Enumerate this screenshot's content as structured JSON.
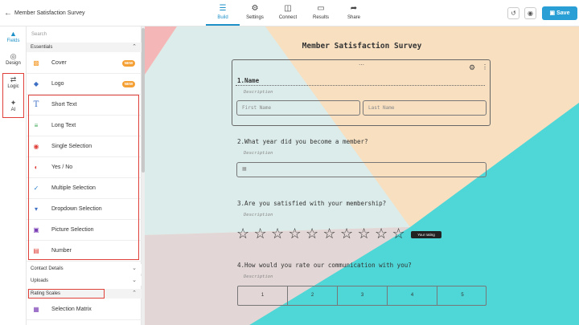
{
  "header": {
    "title": "Member Satisfaction Survey",
    "tabs": [
      {
        "label": "Build",
        "icon": "layers-icon"
      },
      {
        "label": "Settings",
        "icon": "gear-icon"
      },
      {
        "label": "Connect",
        "icon": "connect-icon"
      },
      {
        "label": "Results",
        "icon": "inbox-icon"
      },
      {
        "label": "Share",
        "icon": "share-arrow-icon"
      }
    ],
    "save_label": "Save"
  },
  "rail": {
    "items": [
      {
        "label": "Fields",
        "icon": "fields-icon"
      },
      {
        "label": "Design",
        "icon": "palette-icon"
      },
      {
        "label": "Logic",
        "icon": "shuffle-icon"
      },
      {
        "label": "AI",
        "icon": "sparkle-icon"
      }
    ]
  },
  "panel": {
    "search_placeholder": "Search",
    "essentials_label": "Essentials",
    "essentials": [
      {
        "label": "Cover",
        "badge": "NEW",
        "icon": "cover-icon",
        "color": "#f5a035"
      },
      {
        "label": "Logo",
        "badge": "NEW",
        "icon": "logo-icon",
        "color": "#3d6fc4"
      },
      {
        "label": "Short Text",
        "icon": "text-t-icon",
        "color": "#3d6fc4"
      },
      {
        "label": "Long Text",
        "icon": "long-text-icon",
        "color": "#3aa655"
      },
      {
        "label": "Single Selection",
        "icon": "single-selection-icon",
        "color": "#e0403a"
      },
      {
        "label": "Yes / No",
        "icon": "yes-no-icon",
        "color": "#e0403a"
      },
      {
        "label": "Multiple Selection",
        "icon": "checkmark-icon",
        "color": "#2a7fd0"
      },
      {
        "label": "Dropdown Selection",
        "icon": "dropdown-icon",
        "color": "#3d6fc4"
      },
      {
        "label": "Picture Selection",
        "icon": "picture-icon",
        "color": "#7b3fb5"
      },
      {
        "label": "Number",
        "icon": "number-icon",
        "color": "#e0403a"
      }
    ],
    "contact_label": "Contact Details",
    "uploads_label": "Uploads",
    "rating_label": "Rating Scales",
    "rating_items": [
      {
        "label": "Selection Matrix",
        "icon": "matrix-icon",
        "color": "#7b3fb5"
      }
    ]
  },
  "form": {
    "title": "Member Satisfaction Survey",
    "q1": {
      "label": "1.Name",
      "description": "Description",
      "first_placeholder": "First Name",
      "last_placeholder": "Last Name"
    },
    "q2": {
      "label": "2.What year did you become a member?",
      "description": "Description"
    },
    "q3": {
      "label": "3.Are you satisfied with your membership?",
      "description": "Description",
      "stars": 10,
      "tooltip": "Your rating"
    },
    "q4": {
      "label": "4.How would you rate our communication with you?",
      "description": "Description",
      "scale": [
        "1",
        "2",
        "3",
        "4",
        "5"
      ]
    }
  },
  "colors": {
    "accent": "#1e90c8",
    "save": "#2a9fd6",
    "badge": "#f5a035",
    "highlight": "#e0403a",
    "teal": "#4fd6d6",
    "peach": "#f7dfc0"
  }
}
